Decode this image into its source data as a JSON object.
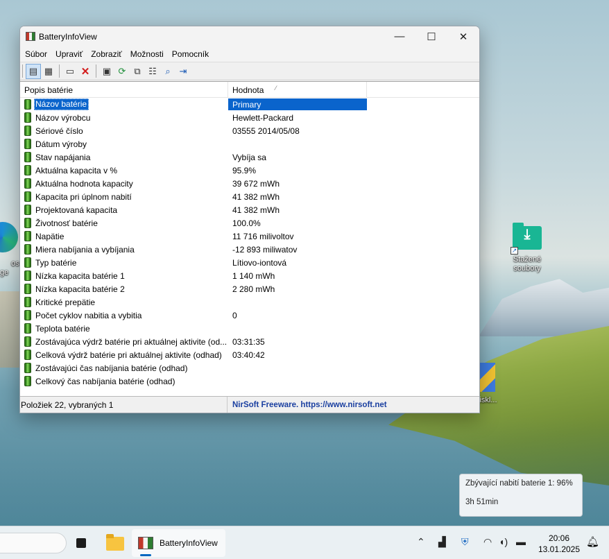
{
  "window": {
    "title": "BatteryInfoView",
    "controls": {
      "minimize": "—",
      "maximize": "☐",
      "close": "✕"
    }
  },
  "menu": [
    "Súbor",
    "Upraviť",
    "Zobraziť",
    "Možnosti",
    "Pomocník"
  ],
  "toolbar": {
    "buttons": [
      "view-battery-info-icon",
      "view-log-icon",
      "window-icon",
      "delete-icon",
      "save-icon",
      "refresh-icon",
      "copy-icon",
      "properties-icon",
      "find-icon",
      "exit-icon"
    ]
  },
  "list": {
    "columns": [
      "Popis batérie",
      "Hodnota"
    ],
    "sort_indicator": "⁄",
    "rows": [
      [
        "Názov batérie",
        "Primary"
      ],
      [
        "Názov výrobcu",
        "Hewlett-Packard"
      ],
      [
        "Sériové číslo",
        "03555 2014/05/08"
      ],
      [
        "Dátum výroby",
        ""
      ],
      [
        "Stav napájania",
        "Vybíja sa"
      ],
      [
        "Aktuálna kapacita v %",
        "95.9%"
      ],
      [
        "Aktuálna hodnota kapacity",
        "39 672 mWh"
      ],
      [
        "Kapacita pri úplnom nabití",
        "41 382 mWh"
      ],
      [
        "Projektovaná kapacita",
        "41 382 mWh"
      ],
      [
        "Životnosť batérie",
        "100.0%"
      ],
      [
        "Napätie",
        "11 716 milivoltov"
      ],
      [
        "Miera nabíjania a vybíjania",
        "-12 893 miliwatov"
      ],
      [
        "Typ batérie",
        "Lítiovo-iontová"
      ],
      [
        "Nízka kapacita batérie 1",
        "1 140 mWh"
      ],
      [
        "Nízka kapacita batérie 2",
        "2 280 mWh"
      ],
      [
        "Kritické prepätie",
        ""
      ],
      [
        "Počet cyklov nabitia a vybitia",
        "0"
      ],
      [
        "Teplota batérie",
        ""
      ],
      [
        "Zostávajúca výdrž batérie pri aktuálnej aktivite (od...",
        "03:31:35"
      ],
      [
        "Celková výdrž batérie pri aktuálnej aktivite (odhad)",
        "03:40:42"
      ],
      [
        "Zostávajúci čas nabíjania batérie (odhad)",
        ""
      ],
      [
        "Celkový čas nabíjania batérie (odhad)",
        ""
      ]
    ],
    "selected_index": 0
  },
  "statusbar": {
    "items": "Položiek 22, vybraných 1",
    "credit": "NirSoft Freeware. https://www.nirsoft.net"
  },
  "desktop": {
    "edge_label_1": "osoft",
    "edge_label_2": "ge",
    "downloads_label_1": "Stažené",
    "downloads_label_2": "soubory",
    "third_label": "iskl..."
  },
  "notification": {
    "line1": "Zbývající nabití baterie 1: 96%",
    "line2": "3h 51min"
  },
  "taskbar": {
    "app_label": "BatteryInfoView",
    "time": "20:06",
    "date": "13.01.2025"
  },
  "colors": {
    "selection": "#0a64cc",
    "credit_text": "#1a3fa0",
    "battery_green": "#58b33a"
  }
}
